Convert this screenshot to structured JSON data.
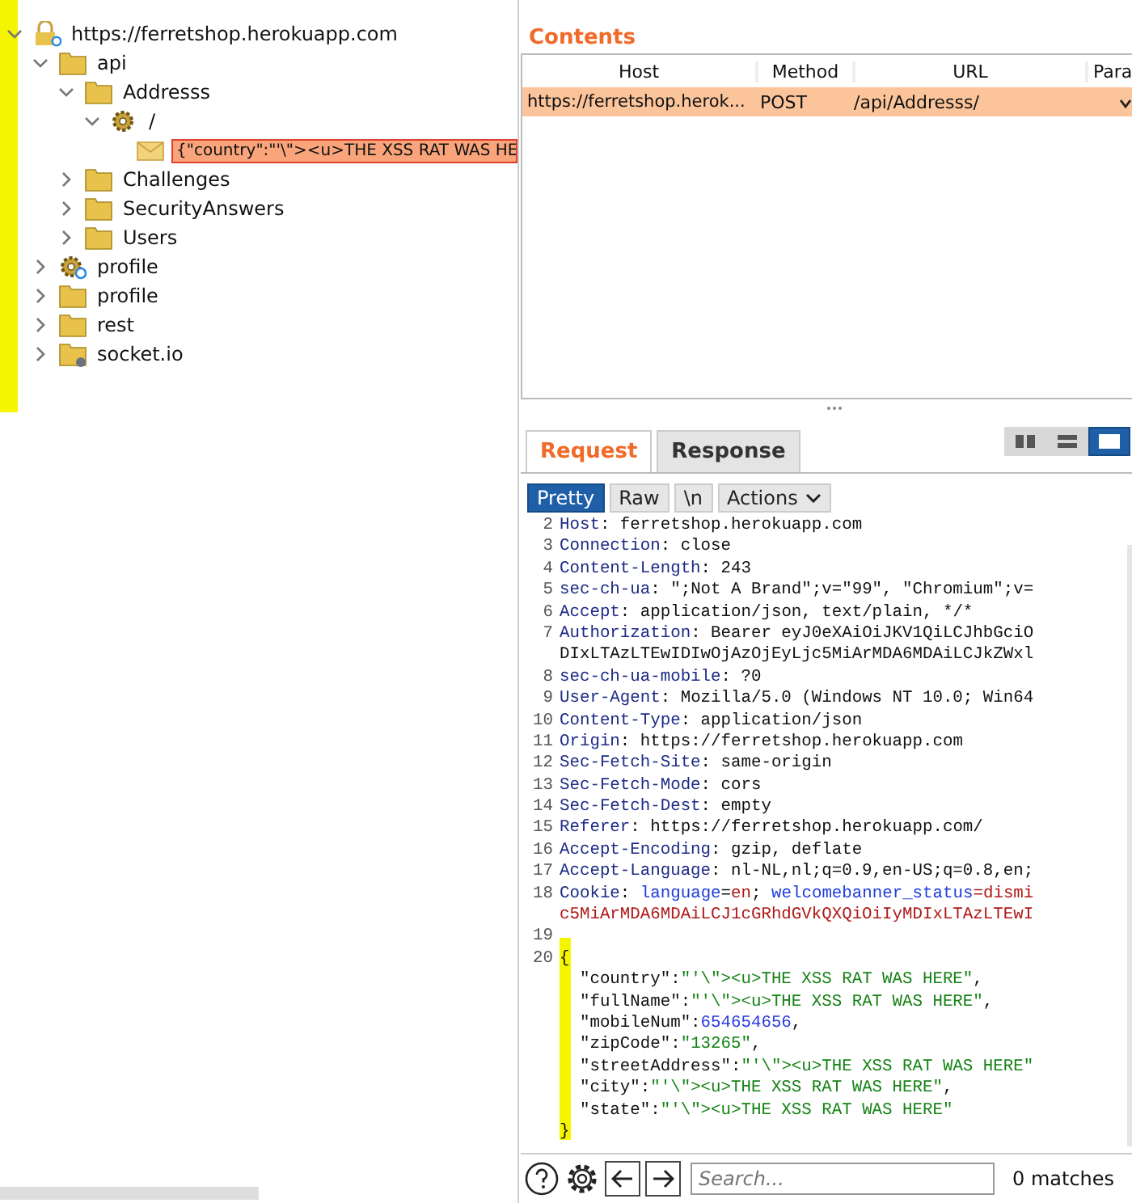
{
  "site_map": {
    "items": [
      {
        "label": "https://ferretshop.herokuapp.com",
        "kind": "host",
        "expanded": true,
        "children": [
          {
            "label": "api",
            "kind": "folder",
            "expanded": true,
            "children": [
              {
                "label": "Addresss",
                "kind": "folder",
                "expanded": true,
                "children": [
                  {
                    "label": "/",
                    "kind": "gear",
                    "expanded": true,
                    "children": [
                      {
                        "label": "{\"country\":\"'\\\"><u>THE XSS RAT WAS HE",
                        "kind": "message",
                        "selected": true
                      }
                    ]
                  }
                ]
              },
              {
                "label": "Challenges",
                "kind": "folder",
                "expanded": false
              },
              {
                "label": "SecurityAnswers",
                "kind": "folder",
                "expanded": false
              },
              {
                "label": "Users",
                "kind": "folder",
                "expanded": false
              }
            ]
          },
          {
            "label": "profile",
            "kind": "gear-badge",
            "expanded": false
          },
          {
            "label": "profile",
            "kind": "folder",
            "expanded": false
          },
          {
            "label": "rest",
            "kind": "folder",
            "expanded": false
          },
          {
            "label": "socket.io",
            "kind": "folder-dot",
            "expanded": false
          }
        ]
      }
    ]
  },
  "contents": {
    "title": "Contents",
    "columns": [
      "Host",
      "Method",
      "URL",
      "Para"
    ],
    "rows": [
      {
        "host": "https://ferretshop.herok...",
        "method": "POST",
        "url": "/api/Addresss/",
        "params": true,
        "selected": true
      }
    ]
  },
  "editor": {
    "tabs": [
      {
        "label": "Request",
        "selected": true
      },
      {
        "label": "Response",
        "selected": false
      }
    ],
    "views": [
      {
        "kind": "columns",
        "selected": false
      },
      {
        "kind": "rows",
        "selected": false
      },
      {
        "kind": "single",
        "selected": true
      }
    ],
    "buttons": [
      {
        "label": "Pretty",
        "selected": true
      },
      {
        "label": "Raw",
        "selected": false
      },
      {
        "label": "\\n",
        "selected": false
      },
      {
        "label": "Actions",
        "selected": false
      }
    ],
    "lines": [
      {
        "num": "2",
        "segments": [
          {
            "text": "Host",
            "kind": "name"
          },
          {
            "text": ": ferretshop.herokuapp.com",
            "kind": "text"
          }
        ]
      },
      {
        "num": "3",
        "segments": [
          {
            "text": "Connection",
            "kind": "name"
          },
          {
            "text": ": close",
            "kind": "text"
          }
        ]
      },
      {
        "num": "4",
        "segments": [
          {
            "text": "Content-Length",
            "kind": "name"
          },
          {
            "text": ": 243",
            "kind": "text"
          }
        ]
      },
      {
        "num": "5",
        "segments": [
          {
            "text": "sec-ch-ua",
            "kind": "name"
          },
          {
            "text": ": \";Not A Brand\";v=\"99\", \"Chromium\";v=",
            "kind": "text"
          }
        ]
      },
      {
        "num": "6",
        "segments": [
          {
            "text": "Accept",
            "kind": "name"
          },
          {
            "text": ": application/json, text/plain, */*",
            "kind": "text"
          }
        ]
      },
      {
        "num": "7",
        "segments": [
          {
            "text": "Authorization",
            "kind": "name"
          },
          {
            "text": ": Bearer eyJ0eXAiOiJKV1QiLCJhbGciO",
            "kind": "text"
          }
        ]
      },
      {
        "segments": [
          {
            "text": "DIxLTAzLTEwIDIwOjAzOjEyLjc5MiArMDA6MDAiLCJkZWxl",
            "kind": "text"
          }
        ]
      },
      {
        "num": "8",
        "segments": [
          {
            "text": "sec-ch-ua-mobile",
            "kind": "name"
          },
          {
            "text": ": ?0",
            "kind": "text"
          }
        ]
      },
      {
        "num": "9",
        "segments": [
          {
            "text": "User-Agent",
            "kind": "name"
          },
          {
            "text": ": Mozilla/5.0 (Windows NT 10.0; Win64",
            "kind": "text"
          }
        ]
      },
      {
        "num": "10",
        "segments": [
          {
            "text": "Content-Type",
            "kind": "name"
          },
          {
            "text": ": application/json",
            "kind": "text"
          }
        ]
      },
      {
        "num": "11",
        "segments": [
          {
            "text": "Origin",
            "kind": "name"
          },
          {
            "text": ": https://ferretshop.herokuapp.com",
            "kind": "text"
          }
        ]
      },
      {
        "num": "12",
        "segments": [
          {
            "text": "Sec-Fetch-Site",
            "kind": "name"
          },
          {
            "text": ": same-origin",
            "kind": "text"
          }
        ]
      },
      {
        "num": "13",
        "segments": [
          {
            "text": "Sec-Fetch-Mode",
            "kind": "name"
          },
          {
            "text": ": cors",
            "kind": "text"
          }
        ]
      },
      {
        "num": "14",
        "segments": [
          {
            "text": "Sec-Fetch-Dest",
            "kind": "name"
          },
          {
            "text": ": empty",
            "kind": "text"
          }
        ]
      },
      {
        "num": "15",
        "segments": [
          {
            "text": "Referer",
            "kind": "name"
          },
          {
            "text": ": https://ferretshop.herokuapp.com/",
            "kind": "text"
          }
        ]
      },
      {
        "num": "16",
        "segments": [
          {
            "text": "Accept-Encoding",
            "kind": "name"
          },
          {
            "text": ": gzip, deflate",
            "kind": "text"
          }
        ]
      },
      {
        "num": "17",
        "segments": [
          {
            "text": "Accept-Language",
            "kind": "name"
          },
          {
            "text": ": nl-NL,nl;q=0.9,en-US;q=0.8,en;",
            "kind": "text"
          }
        ]
      },
      {
        "num": "18",
        "segments": [
          {
            "text": "Cookie",
            "kind": "name"
          },
          {
            "text": ": ",
            "kind": "text"
          },
          {
            "text": "language",
            "kind": "cookie"
          },
          {
            "text": "=",
            "kind": "text"
          },
          {
            "text": "en",
            "kind": "value"
          },
          {
            "text": "; ",
            "kind": "text"
          },
          {
            "text": "welcomebanner_status",
            "kind": "cookie"
          },
          {
            "text": "=dismi",
            "kind": "value"
          }
        ]
      },
      {
        "segments": [
          {
            "text": "c5MiArMDA6MDAiLCJ1cGRhdGVkQXQiOiIyMDIxLTAzLTEwI",
            "kind": "value"
          }
        ]
      },
      {
        "num": "19"
      },
      {
        "num": "20",
        "segments": [
          {
            "text": "{",
            "kind": "text"
          }
        ]
      },
      {
        "segments": [
          {
            "text": "  \"country\":",
            "kind": "text"
          },
          {
            "text": "\"'\\\"><u>THE XSS RAT WAS HERE\"",
            "kind": "string"
          },
          {
            "text": ",",
            "kind": "text"
          }
        ]
      },
      {
        "segments": [
          {
            "text": "  \"fullName\":",
            "kind": "text"
          },
          {
            "text": "\"'\\\"><u>THE XSS RAT WAS HERE\"",
            "kind": "string"
          },
          {
            "text": ",",
            "kind": "text"
          }
        ]
      },
      {
        "segments": [
          {
            "text": "  \"mobileNum\":",
            "kind": "text"
          },
          {
            "text": "654654656",
            "kind": "number"
          },
          {
            "text": ",",
            "kind": "text"
          }
        ]
      },
      {
        "segments": [
          {
            "text": "  \"zipCode\":",
            "kind": "text"
          },
          {
            "text": "\"13265\"",
            "kind": "string"
          },
          {
            "text": ",",
            "kind": "text"
          }
        ]
      },
      {
        "segments": [
          {
            "text": "  \"streetAddress\":",
            "kind": "text"
          },
          {
            "text": "\"'\\\"><u>THE XSS RAT WAS HERE\"",
            "kind": "string"
          }
        ]
      },
      {
        "segments": [
          {
            "text": "  \"city\":",
            "kind": "text"
          },
          {
            "text": "\"'\\\"><u>THE XSS RAT WAS HERE\"",
            "kind": "string"
          },
          {
            "text": ",",
            "kind": "text"
          }
        ]
      },
      {
        "segments": [
          {
            "text": "  \"state\":",
            "kind": "text"
          },
          {
            "text": "\"'\\\"><u>THE XSS RAT WAS HERE\"",
            "kind": "string"
          }
        ]
      },
      {
        "segments": [
          {
            "text": "}",
            "kind": "text"
          }
        ]
      }
    ],
    "search": {
      "placeholder": "Search..."
    },
    "matches": "0 matches"
  }
}
